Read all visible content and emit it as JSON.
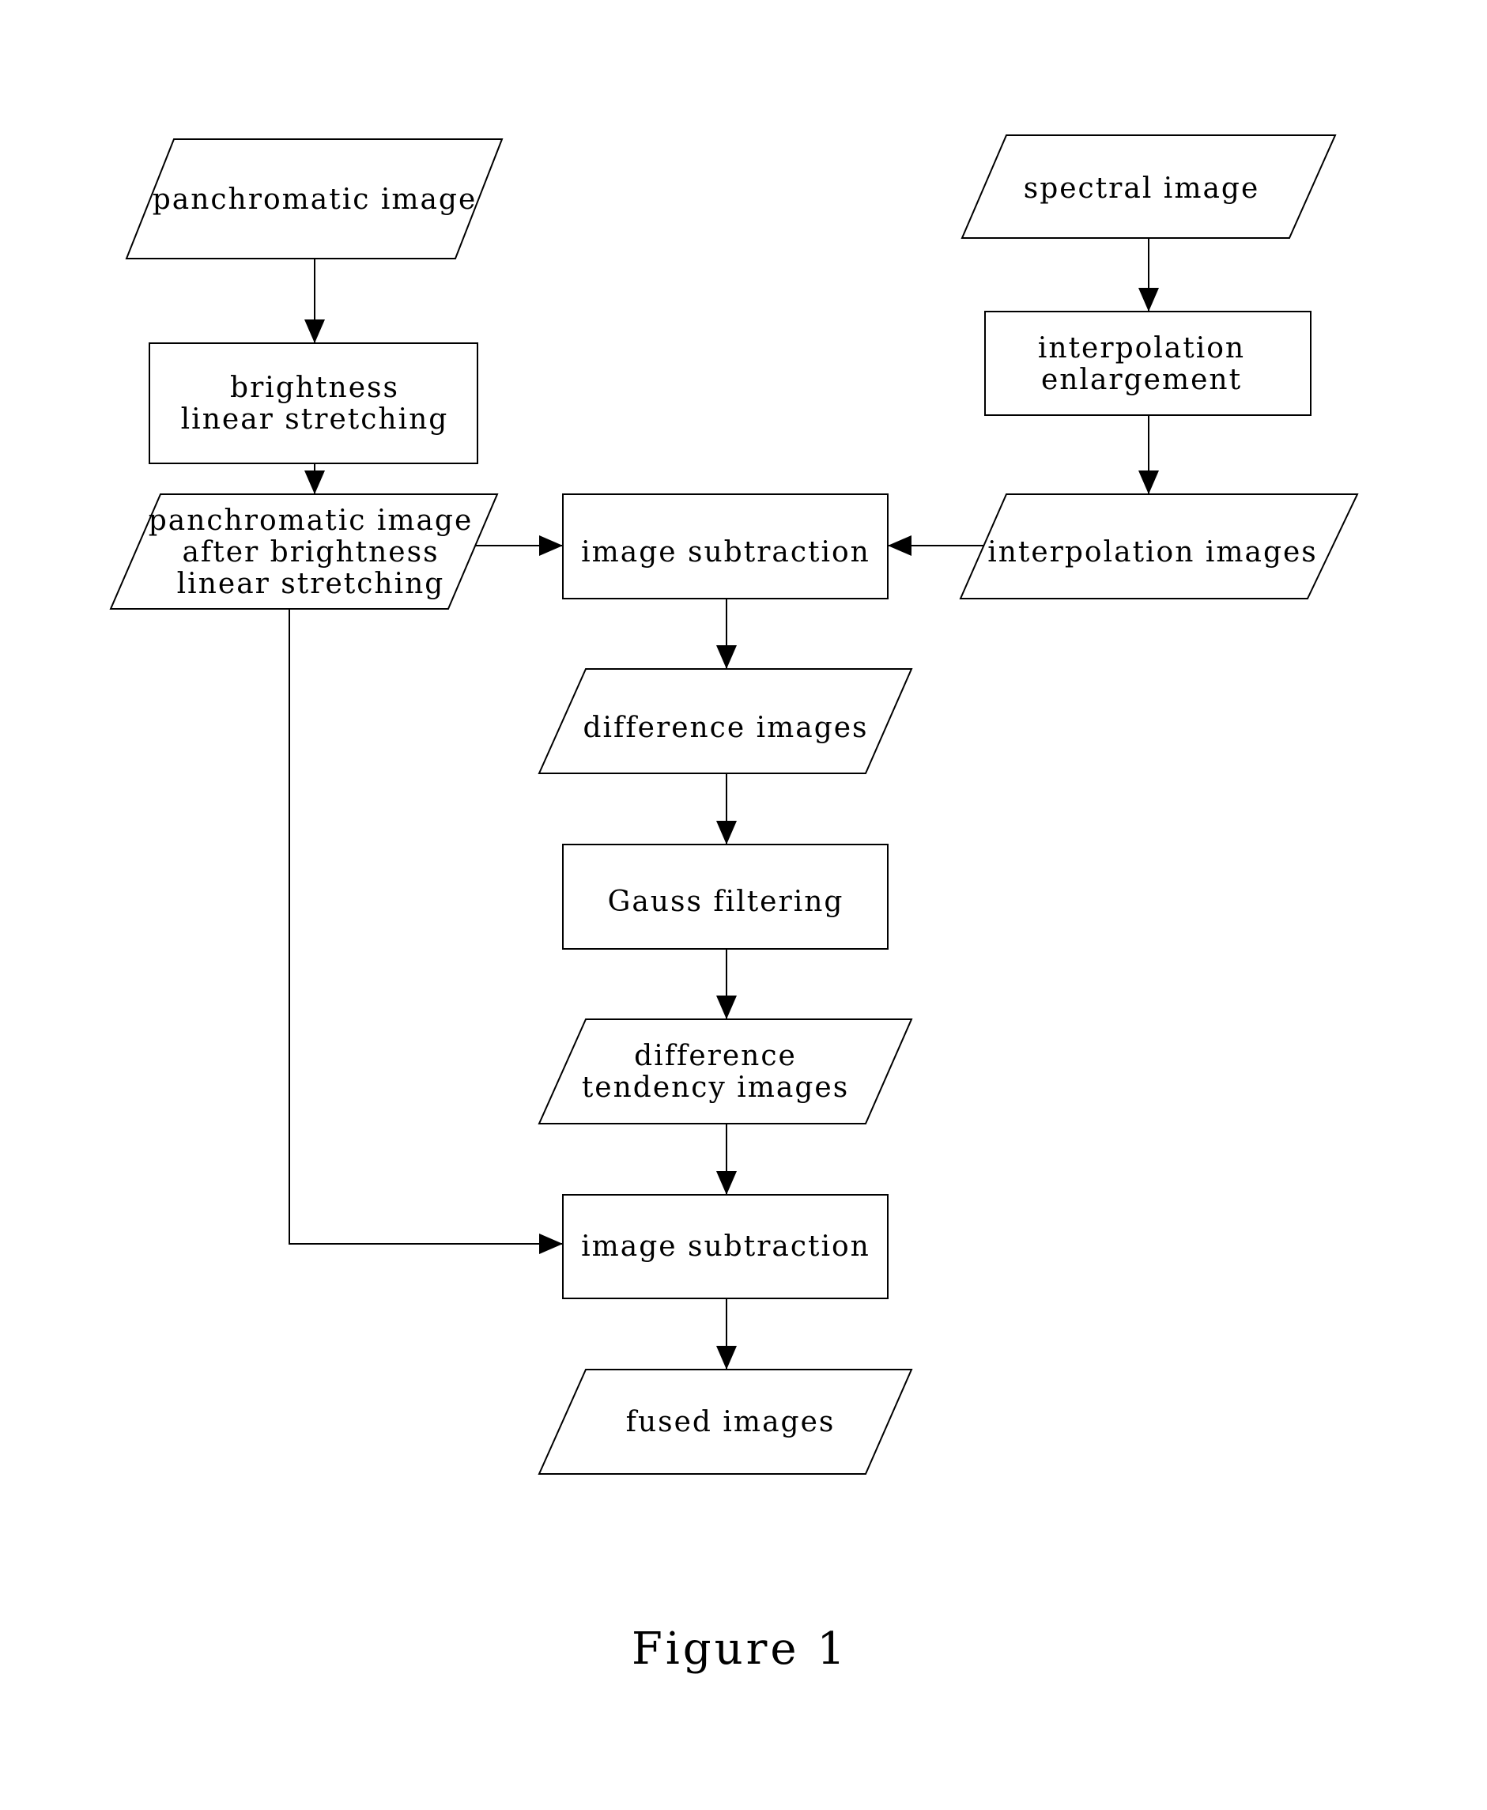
{
  "diagram": {
    "nodes": [
      {
        "id": "panchromatic",
        "shape": "parallelogram",
        "lines": [
          "panchromatic image"
        ]
      },
      {
        "id": "brightness",
        "shape": "rect",
        "lines": [
          "brightness",
          "linear stretching"
        ]
      },
      {
        "id": "pan_after",
        "shape": "parallelogram",
        "lines": [
          "panchromatic image",
          "after brightness",
          "linear stretching"
        ]
      },
      {
        "id": "spectral",
        "shape": "parallelogram",
        "lines": [
          "spectral image"
        ]
      },
      {
        "id": "interp_enlarge",
        "shape": "rect",
        "lines": [
          "interpolation",
          "enlargement"
        ]
      },
      {
        "id": "interp_images",
        "shape": "parallelogram",
        "lines": [
          "interpolation images"
        ]
      },
      {
        "id": "subtract1",
        "shape": "rect",
        "lines": [
          "image subtraction"
        ]
      },
      {
        "id": "diff_images",
        "shape": "parallelogram",
        "lines": [
          "difference images"
        ]
      },
      {
        "id": "gauss",
        "shape": "rect",
        "lines": [
          "Gauss filtering"
        ]
      },
      {
        "id": "diff_tendency",
        "shape": "parallelogram",
        "lines": [
          "difference",
          "tendency images"
        ]
      },
      {
        "id": "subtract2",
        "shape": "rect",
        "lines": [
          "image subtraction"
        ]
      },
      {
        "id": "fused",
        "shape": "parallelogram",
        "lines": [
          "fused images"
        ]
      }
    ],
    "edges": [
      {
        "from": "panchromatic",
        "to": "brightness"
      },
      {
        "from": "brightness",
        "to": "pan_after"
      },
      {
        "from": "spectral",
        "to": "interp_enlarge"
      },
      {
        "from": "interp_enlarge",
        "to": "interp_images"
      },
      {
        "from": "pan_after",
        "to": "subtract1"
      },
      {
        "from": "interp_images",
        "to": "subtract1"
      },
      {
        "from": "subtract1",
        "to": "diff_images"
      },
      {
        "from": "diff_images",
        "to": "gauss"
      },
      {
        "from": "gauss",
        "to": "diff_tendency"
      },
      {
        "from": "diff_tendency",
        "to": "subtract2"
      },
      {
        "from": "pan_after",
        "to": "subtract2"
      },
      {
        "from": "subtract2",
        "to": "fused"
      }
    ],
    "caption": "Figure 1"
  }
}
